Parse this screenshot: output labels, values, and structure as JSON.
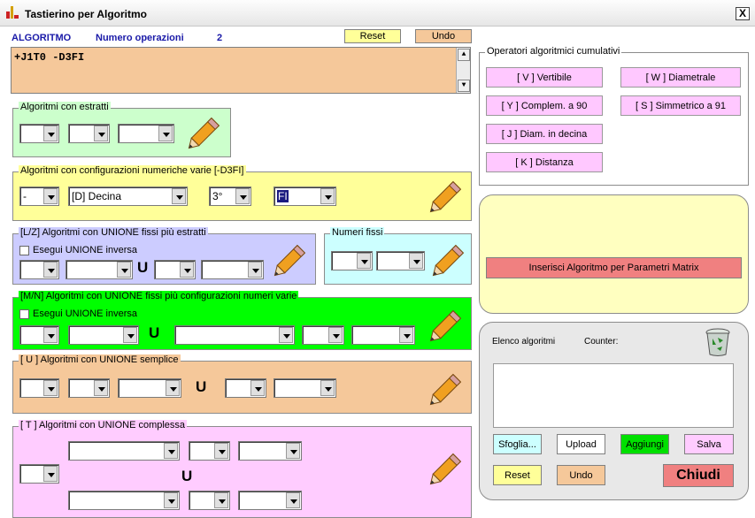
{
  "window": {
    "title": "Tastierino per Algoritmo",
    "close_glyph": "X"
  },
  "header": {
    "algoritmo": "ALGORITMO",
    "numero_label": "Numero operazioni",
    "numero_value": "2",
    "reset": "Reset",
    "undo": "Undo"
  },
  "algorithm_text": "+J1T0 -D3FI",
  "groups": {
    "estratti": {
      "label": "Algoritmi con estratti"
    },
    "config": {
      "label": "Algoritmi con configurazioni numeriche varie  [-D3FI]",
      "sign": "-",
      "type": "[D] Decina",
      "pos": "3°",
      "code": "FI"
    },
    "lz": {
      "label": "[L/Z] Algoritmi con UNIONE fissi più estratti",
      "checkbox": "Esegui UNIONE inversa"
    },
    "fissi": {
      "label": "Numeri fissi"
    },
    "mn": {
      "label": "[M/N] Algoritmi con UNIONE fissi più configurazioni numeri varie",
      "checkbox": "Esegui UNIONE inversa"
    },
    "u": {
      "label": "[ U ] Algoritmi con UNIONE semplice"
    },
    "t": {
      "label": "[ T ] Algoritmi con UNIONE complessa"
    }
  },
  "union_symbol": "U",
  "operators": {
    "label": "Operatori algoritmici cumulativi",
    "buttons": [
      "[ V ] Vertibile",
      "[ W ] Diametrale",
      "[ Y ] Complem. a 90",
      "[ S ] Simmetrico  a 91",
      "[ J ] Diam. in decina",
      "[ K ] Distanza"
    ]
  },
  "matrix_button": "Inserisci Algoritmo per Parametri Matrix",
  "elenco": {
    "label": "Elenco algoritmi",
    "counter": "Counter:"
  },
  "bottom_buttons": {
    "sfoglia": "Sfoglia...",
    "upload": "Upload",
    "aggiungi": "Aggiungi",
    "salva": "Salva",
    "reset": "Reset",
    "undo": "Undo",
    "chiudi": "Chiudi"
  },
  "icons": [
    "app-icon",
    "close-icon",
    "pencil-icon",
    "recycle-bin-icon",
    "chevron-down-icon"
  ],
  "colors": {
    "peach": "#f5c89a",
    "yellow": "#ffff99",
    "green": "#00ff00",
    "lightgreen": "#ccffcc",
    "lavender": "#ccccff",
    "cyan": "#ccffff",
    "pink": "#ffccff",
    "matrix": "#f08080"
  }
}
